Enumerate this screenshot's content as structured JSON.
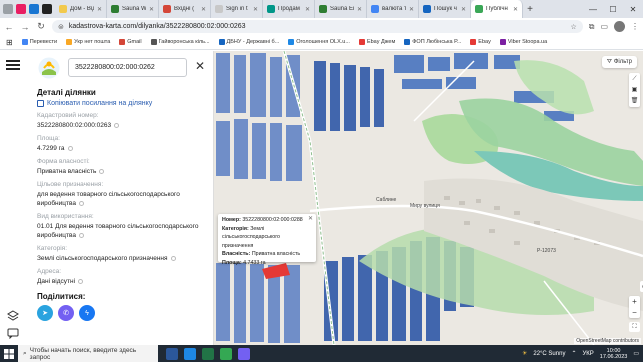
{
  "browser": {
    "tabs": [
      {
        "label": "Дом - Відд",
        "color": "#f2c94c"
      },
      {
        "label": "Sauna W",
        "color": "#2e7d32"
      },
      {
        "label": "Вхідні (",
        "color": "#d44638"
      },
      {
        "label": "Sign in t",
        "color": "#c8c8c8"
      },
      {
        "label": "Продам",
        "color": "#009688"
      },
      {
        "label": "Sauna Ei",
        "color": "#2e7d32"
      },
      {
        "label": "валюта т",
        "color": "#4285f4"
      },
      {
        "label": "Пошук ч",
        "color": "#1565c0"
      },
      {
        "label": "Публічн",
        "color": "#3aa757",
        "active": true
      }
    ],
    "new_tab": "+",
    "window_controls": {
      "minimize": "—",
      "maximize": "☐",
      "close": "✕"
    },
    "url": "kadastrova-karta.com/dilyanka/3522280800:02:000:0263",
    "bookmarks": [
      {
        "label": "Перевести",
        "color": "#4285f4"
      },
      {
        "label": "Укр нет пошта",
        "color": "#f9a825"
      },
      {
        "label": "Gmail",
        "color": "#d44638"
      },
      {
        "label": "Гайворонська кіль...",
        "color": "#555555"
      },
      {
        "label": "ДБНУ - Державні б...",
        "color": "#1565c0"
      },
      {
        "label": "Оголошення OLX.u...",
        "color": "#1e88e5"
      },
      {
        "label": "Ebay Джем",
        "color": "#e53935"
      },
      {
        "label": "ФОП Любінська Р...",
        "color": "#1565c0"
      },
      {
        "label": "Ebay",
        "color": "#e53935"
      },
      {
        "label": "Viber Stoopa.ua",
        "color": "#7b1fa2"
      }
    ]
  },
  "panel": {
    "search_value": "3522280800:02:000:0262",
    "title": "Деталі ділянки",
    "copy_link": "Копіювати посилання на ділянку",
    "fields": [
      {
        "label": "Кадастровий номер:",
        "value": "3522280800:02:000:0263"
      },
      {
        "label": "Площа:",
        "value": "4.7299 га"
      },
      {
        "label": "Форма власності:",
        "value": "Приватна власність"
      },
      {
        "label": "Цільове призначення:",
        "value": "для ведення товарного сільськогосподарського виробництва"
      },
      {
        "label": "Вид використання:",
        "value": "01.01 Для ведення товарного сільськогосподарського виробництва"
      },
      {
        "label": "Категорія:",
        "value": "Землі сільськогосподарського призначення"
      },
      {
        "label": "Адреса:",
        "value": "Дані відсутні"
      }
    ],
    "share_title": "Поділитися:",
    "share": [
      {
        "name": "telegram",
        "color": "#2aa3df",
        "glyph": "➤"
      },
      {
        "name": "viber",
        "color": "#7360f2",
        "glyph": "✆"
      },
      {
        "name": "messenger",
        "color": "#1877f2",
        "glyph": "ϟ"
      }
    ]
  },
  "map": {
    "filter_label": "Фільтр",
    "popup": [
      {
        "k": "Номер:",
        "v": "3522280800:02:000:0288"
      },
      {
        "k": "Категорія:",
        "v": "Землі сільськогосподарського призначення"
      },
      {
        "k": "Власність:",
        "v": "Приватна власність"
      },
      {
        "k": "Площа:",
        "v": "4.7433 га"
      }
    ],
    "labels": {
      "village": "Саблине",
      "street": "Миру вулиця",
      "road": "Р-12073",
      "zoom_in": "+",
      "zoom_out": "−"
    },
    "attribution": "OpenStreetMap contributors"
  },
  "taskbar": {
    "search_placeholder": "Чтобы начать поиск, введите здесь запрос",
    "weather": "22°C Sunny",
    "lang": "УКР",
    "time": "10:00",
    "date": "17.06.2023",
    "apps": [
      "#2b579a",
      "#1e88e5",
      "#217346",
      "#34a853",
      "#7360f2"
    ]
  }
}
